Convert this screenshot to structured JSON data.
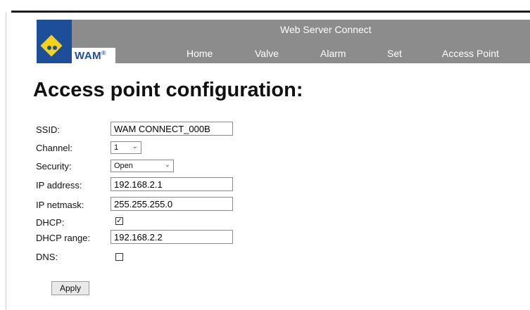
{
  "header": {
    "title": "Web Server Connect",
    "brand": "WAM",
    "brand_mark": "®",
    "brand_color": "#1d4e9a",
    "logo_color": "#f2d21b",
    "header_bg": "#8c8c8c",
    "nav": [
      "Home",
      "Valve",
      "Alarm",
      "Set",
      "Access Point"
    ]
  },
  "page": {
    "title": "Access point configuration:"
  },
  "form": {
    "ssid_label": "SSID:",
    "ssid_value": "WAM CONNECT_000B",
    "channel_label": "Channel:",
    "channel_value": "1",
    "security_label": "Security:",
    "security_value": "Open",
    "ip_label": "IP address:",
    "ip_value": "192.168.2.1",
    "netmask_label": "IP netmask:",
    "netmask_value": "255.255.255.0",
    "dhcp_label": "DHCP:",
    "dhcp_checked": true,
    "dhcp_range_label": "DHCP range:",
    "dhcp_range_value": "192.168.2.2",
    "dns_label": "DNS:",
    "dns_checked": false,
    "apply_label": "Apply"
  },
  "icons": {
    "select_arrow": "chevron-down-icon",
    "check": "checkmark-icon"
  }
}
